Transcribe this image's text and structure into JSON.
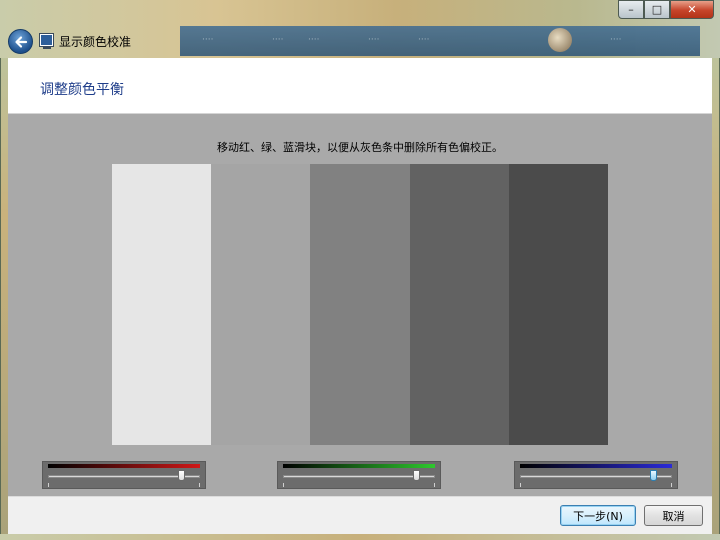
{
  "window": {
    "title": "显示颜色校准",
    "minimize_glyph": "–",
    "maximize_glyph": "□",
    "close_glyph": "✕"
  },
  "header": {
    "title": "调整颜色平衡"
  },
  "main": {
    "instruction": "移动红、绿、蓝滑块，以便从灰色条中删除所有色偏校正。",
    "bars": [
      {
        "color": "#e6e6e6"
      },
      {
        "color": "#a5a5a5"
      },
      {
        "color": "#818181"
      },
      {
        "color": "#626262"
      },
      {
        "color": "#4b4b4b"
      }
    ],
    "sliders": [
      {
        "channel": "red",
        "color": "#d01818",
        "value_percent": 88
      },
      {
        "channel": "green",
        "color": "#2ec92e",
        "value_percent": 88
      },
      {
        "channel": "blue",
        "color": "#2a2ad8",
        "value_percent": 88
      }
    ]
  },
  "footer": {
    "next_label": "下一步(N)",
    "cancel_label": "取消"
  },
  "icons": {
    "back": "back-arrow-icon",
    "app": "monitor-icon"
  }
}
